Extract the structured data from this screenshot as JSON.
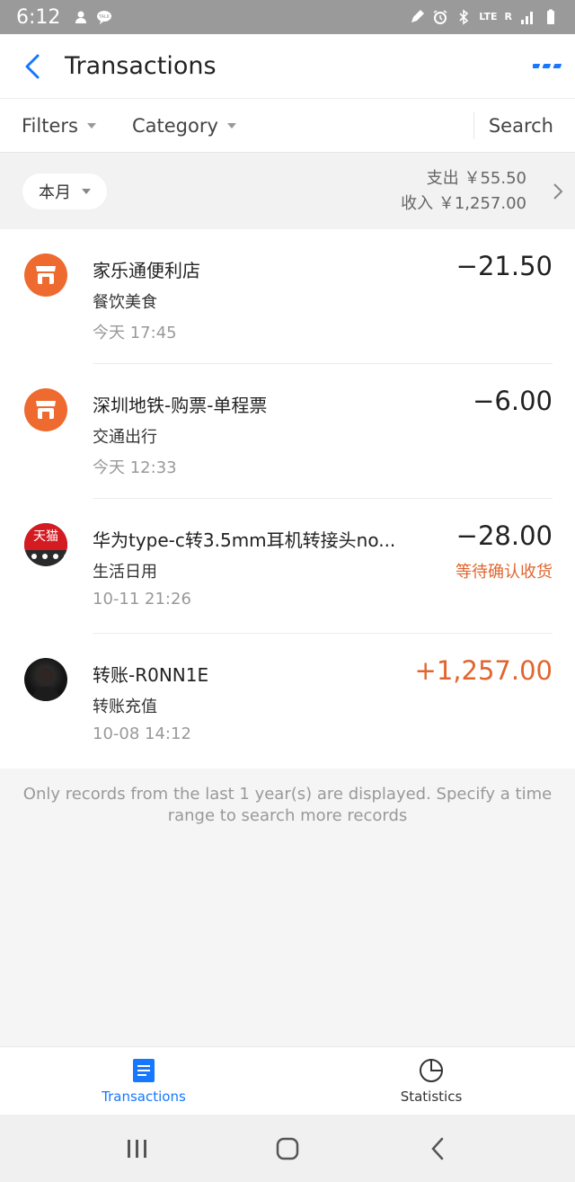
{
  "status_bar": {
    "time": "6:12",
    "lte_label": "LTE",
    "r_label": "R"
  },
  "header": {
    "title": "Transactions"
  },
  "filters": {
    "filters_label": "Filters",
    "category_label": "Category",
    "search_label": "Search"
  },
  "month_bar": {
    "period_label": "本月",
    "expense_label": "支出 ￥55.50",
    "income_label": "收入 ￥1,257.00"
  },
  "transactions": [
    {
      "title": "家乐通便利店",
      "category": "餐饮美食",
      "time": "今天  17:45",
      "amount": "−21.50",
      "status": "",
      "icon": "store-icon"
    },
    {
      "title": "深圳地铁-购票-单程票",
      "category": "交通出行",
      "time": "今天  12:33",
      "amount": "−6.00",
      "status": "",
      "icon": "store-icon"
    },
    {
      "title": "华为type-c转3.5mm耳机转接头no...",
      "category": "生活日用",
      "time": "10-11  21:26",
      "amount": "−28.00",
      "status": "等待确认收货",
      "icon": "tmall-icon",
      "icon_text": "天猫"
    },
    {
      "title": "转账-R0NN1E",
      "category": "转账充值",
      "time": "10-08  14:12",
      "amount": "+1,257.00",
      "status": "",
      "icon": "user-photo-avatar"
    }
  ],
  "footer_note": "Only records from the last 1 year(s) are displayed. Specify a time range to search more records",
  "tabs": [
    {
      "label": "Transactions",
      "active": true
    },
    {
      "label": "Statistics",
      "active": false
    }
  ],
  "colors": {
    "accent": "#1677ff",
    "orange": "#e0652e",
    "store_icon": "#ee6a2f",
    "tmall_red": "#d41b22"
  }
}
